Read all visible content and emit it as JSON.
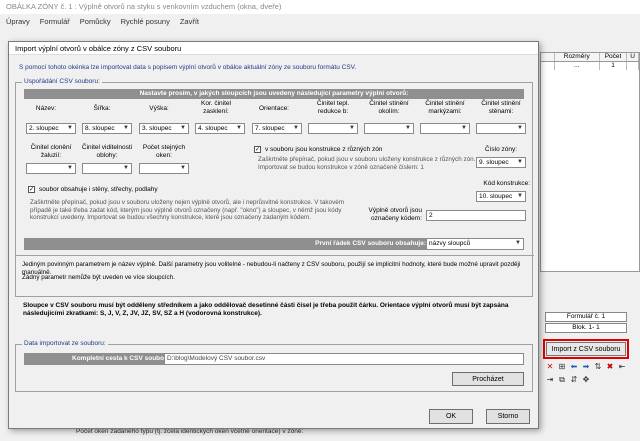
{
  "parent": {
    "title": "OBÁLKA ZÓNY č. 1 : Výplně otvorů na styku s venkovním vzduchem (okna, dveře)",
    "menu": [
      "Úpravy",
      "Formulář",
      "Pomůcky",
      "Rychlé posuny",
      "Zavřít"
    ],
    "table_headers": [
      "",
      "Rozměry",
      "Počet",
      "U"
    ],
    "table_row": [
      "",
      "...",
      "1",
      ""
    ],
    "form_field": "Formulář č. 1",
    "block_field": "Blok. 1- 1",
    "import_button": "Import z CSV souboru",
    "bottom_text": "Počet oken zadaného typu (tj. zcela identických oken včetně orientace) v zóně:"
  },
  "dialog": {
    "title": "Import výplní otvorů v obálce zóny z CSV souboru",
    "description": "S pomocí tohoto okénka lze importovat data s popisem výplní otvorů v obálce aktuální zóny ze souboru formátu CSV.",
    "group1_label": "Uspořádání CSV souboru:",
    "section_header": "Nastavte prosím, v jakých sloupcích jsou uvedeny následující parametry výplní otvorů:",
    "row1": [
      {
        "label": "Název:",
        "value": "2. sloupec"
      },
      {
        "label": "Šířka:",
        "value": "8. sloupec"
      },
      {
        "label": "Výška:",
        "value": "3. sloupec"
      },
      {
        "label": "Kor. činitel zasklení:",
        "value": "4. sloupec"
      },
      {
        "label": "Orientace:",
        "value": "7. sloupec"
      },
      {
        "label": "Činitel tepl. redukce b:",
        "value": ""
      },
      {
        "label": "Činitel stínění okolím:",
        "value": ""
      },
      {
        "label": "Činitel stínění markýzami:",
        "value": ""
      },
      {
        "label": "Činitel stínění stěnami:",
        "value": ""
      }
    ],
    "row2": [
      {
        "label": "Činitel clonění žaluzií:",
        "value": ""
      },
      {
        "label": "Činitel viditelnosti oblohy:",
        "value": ""
      },
      {
        "label": "Počet stejných oken:",
        "value": ""
      }
    ],
    "zones_checkbox": "v souboru jsou konstrukce z různých zón",
    "zones_note": "Zaškrtněte přepínač, pokud jsou v souboru uloženy konstrukce z různých zón. Importovat se budou konstrukce v zóně označené číslem: 1",
    "zone_number_label": "Číslo zóny:",
    "zone_number_value": "9. sloupec",
    "walls_checkbox": "soubor obsahuje i stěny, střechy, podlahy",
    "walls_note": "Zaškrtněte přepínač, pokud jsou v souboru uloženy nejen výplně otvorů, ale i neprůsvitné konstrukce. V takovém případě je také třeba zadat kód, kterým jsou výplně otvorů označeny (např. \"okno\") a sloupec, v němž jsou kódy konstrukcí uvedeny. Importovat se budou všechny konstrukce, které jsou označeny zadaným kódem.",
    "code_column_label": "Kód konstrukce:",
    "code_column_value": "10. sloupec",
    "code_label": "Výplně otvorů jsou označeny kódem:",
    "code_value": "2",
    "first_row_label": "První řádek CSV souboru obsahuje:",
    "first_row_value": "názvy sloupců",
    "info1": "Jediným povinným parametrem je název výplně. Další parametry jsou volitelné - nebudou-li načteny z CSV souboru, použijí se implicitní hodnoty, které bude možné upravit později manuálně.",
    "info2": "Žádný parametr nemůže být uveden ve více sloupcích.",
    "info_bold": "Sloupce v CSV souboru musí být odděleny středníkem a jako oddělovač desetinné části čísel je třeba použít čárku. Orientace výplní otvorů musí být zapsána následujícími zkratkami: S, J, V, Z, JV, JZ, SV, SZ a H (vodorovná konstrukce).",
    "group2_label": "Data importovat ze souboru:",
    "path_label": "Kompletní cesta k CSV souboru:",
    "path_value": "D:\\blog\\Modelový CSV soubor.csv",
    "browse_button": "Procházet",
    "ok_button": "OK",
    "cancel_button": "Storno"
  }
}
